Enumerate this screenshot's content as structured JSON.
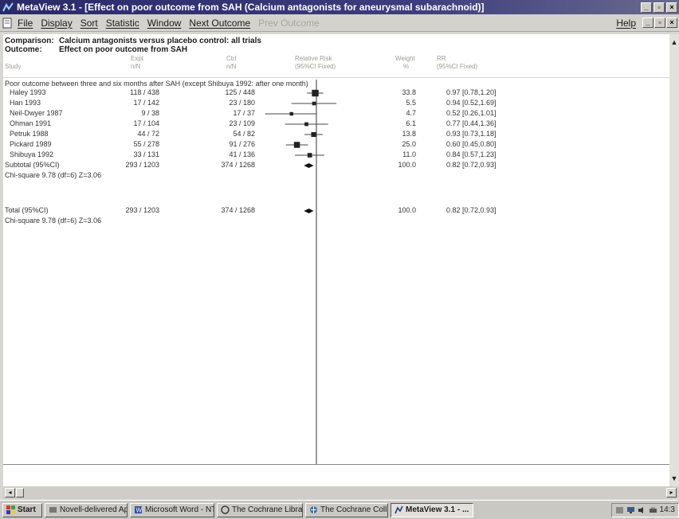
{
  "window": {
    "title": "MetaView 3.1 - [Effect on poor outcome from SAH (Calcium antagonists for aneurysmal subarachnoid)]"
  },
  "menu": {
    "items": [
      "File",
      "Display",
      "Sort",
      "Statistic",
      "Window",
      "Next Outcome",
      "Prev Outcome"
    ],
    "disabled_index": 6,
    "help": "Help"
  },
  "report": {
    "comparison_label": "Comparison:",
    "comparison": "Calcium antagonists versus placebo control: all trials",
    "outcome_label": "Outcome:",
    "outcome": "Effect on poor outcome from SAH",
    "columns": {
      "study": "Study",
      "expt_1": "Expt",
      "expt_2": "n/N",
      "ctrl_1": "Ctrl",
      "ctrl_2": "n/N",
      "rr_1": "Relative Risk",
      "rr_2": "(95%CI Fixed)",
      "weight_1": "Weight",
      "weight_2": "%",
      "rrci_1": "RR",
      "rrci_2": "(95%CI Fixed)"
    },
    "group_heading": "Poor outcome between three and six months after SAH (except Shibuya 1992: after one month)",
    "studies": [
      {
        "name": "Haley 1993",
        "expt": "118 / 438",
        "ctrl": "125 / 448",
        "weight": "33.8",
        "rr_ci": "0.97 [0.78,1.20]"
      },
      {
        "name": "Han 1993",
        "expt": "17 / 142",
        "ctrl": "23 / 180",
        "weight": "5.5",
        "rr_ci": "0.94 [0.52,1.69]"
      },
      {
        "name": "Neil-Dwyer 1987",
        "expt": "9 / 38",
        "ctrl": "17 / 37",
        "weight": "4.7",
        "rr_ci": "0.52 [0.26,1.01]"
      },
      {
        "name": "Ohman 1991",
        "expt": "17 / 104",
        "ctrl": "23 / 109",
        "weight": "6.1",
        "rr_ci": "0.77 [0.44,1.36]"
      },
      {
        "name": "Petruk 1988",
        "expt": "44 / 72",
        "ctrl": "54 / 82",
        "weight": "13.8",
        "rr_ci": "0.93 [0.73,1.18]"
      },
      {
        "name": "Pickard 1989",
        "expt": "55 / 278",
        "ctrl": "91 / 276",
        "weight": "25.0",
        "rr_ci": "0.60 [0.45,0.80]"
      },
      {
        "name": "Shibuya 1992",
        "expt": "33 / 131",
        "ctrl": "41 / 136",
        "weight": "11.0",
        "rr_ci": "0.84 [0.57,1.23]"
      }
    ],
    "subtotal": {
      "name": "Subtotal (95%CI)",
      "expt": "293 / 1203",
      "ctrl": "374 / 1268",
      "weight": "100.0",
      "rr_ci": "0.82 [0.72,0.93]"
    },
    "subtotal_stats": "Chi-square 9.78 (df=6)  Z=3.06",
    "total": {
      "name": "Total (95%CI)",
      "expt": "293 / 1203",
      "ctrl": "374 / 1268",
      "weight": "100.0",
      "rr_ci": "0.82 [0.72,0.93]"
    },
    "total_stats": "Chi-square 9.78 (df=6)  Z=3.06"
  },
  "chart_data": {
    "type": "forest",
    "scale": "log",
    "reference_line": 1,
    "xlim": [
      0.1,
      10
    ],
    "points": [
      {
        "study": "Haley 1993",
        "rr": 0.97,
        "lo": 0.78,
        "hi": 1.2,
        "weight": 33.8
      },
      {
        "study": "Han 1993",
        "rr": 0.94,
        "lo": 0.52,
        "hi": 1.69,
        "weight": 5.5
      },
      {
        "study": "Neil-Dwyer 1987",
        "rr": 0.52,
        "lo": 0.26,
        "hi": 1.01,
        "weight": 4.7
      },
      {
        "study": "Ohman 1991",
        "rr": 0.77,
        "lo": 0.44,
        "hi": 1.36,
        "weight": 6.1
      },
      {
        "study": "Petruk 1988",
        "rr": 0.93,
        "lo": 0.73,
        "hi": 1.18,
        "weight": 13.8
      },
      {
        "study": "Pickard 1989",
        "rr": 0.6,
        "lo": 0.45,
        "hi": 0.8,
        "weight": 25.0
      },
      {
        "study": "Shibuya 1992",
        "rr": 0.84,
        "lo": 0.57,
        "hi": 1.23,
        "weight": 11.0
      }
    ],
    "pooled": [
      {
        "label": "Subtotal (95%CI)",
        "rr": 0.82,
        "lo": 0.72,
        "hi": 0.93
      },
      {
        "label": "Total (95%CI)",
        "rr": 0.82,
        "lo": 0.72,
        "hi": 0.93
      }
    ]
  },
  "taskbar": {
    "start": "Start",
    "items": [
      {
        "label": "Novell-delivered Ap...",
        "icon": "novell-icon"
      },
      {
        "label": "Microsoft Word - NT",
        "icon": "word-icon"
      },
      {
        "label": "The Cochrane Libra...",
        "icon": "cochrane-library-icon"
      },
      {
        "label": "The Cochrane Colla...",
        "icon": "cochrane-collaboration-icon"
      },
      {
        "label": "MetaView 3.1 - ...",
        "icon": "metaview-icon"
      }
    ],
    "active_index": 4,
    "clock": "14:3"
  }
}
